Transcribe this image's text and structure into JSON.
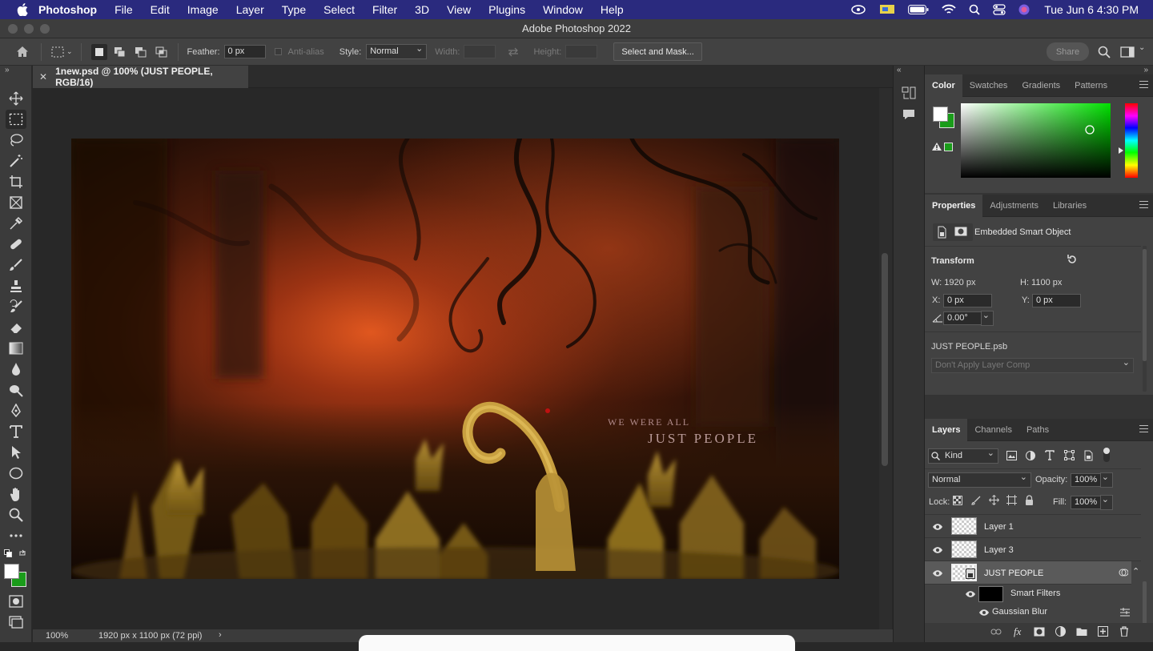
{
  "macmenu": {
    "app": "Photoshop",
    "items": [
      "File",
      "Edit",
      "Image",
      "Layer",
      "Type",
      "Select",
      "Filter",
      "3D",
      "View",
      "Plugins",
      "Window",
      "Help"
    ],
    "clock": "Tue Jun 6  4:30 PM"
  },
  "window": {
    "title": "Adobe Photoshop 2022"
  },
  "options": {
    "feather_label": "Feather:",
    "feather_value": "0 px",
    "antialias_label": "Anti-alias",
    "style_label": "Style:",
    "style_value": "Normal",
    "width_label": "Width:",
    "height_label": "Height:",
    "select_mask": "Select and Mask...",
    "share": "Share"
  },
  "document": {
    "tab_title": "1new.psd @ 100% (JUST PEOPLE, RGB/16)",
    "artwork_line1": "WE WERE ALL",
    "artwork_line2": "JUST PEOPLE"
  },
  "status": {
    "zoom": "100%",
    "size": "1920 px x 1100 px (72 ppi)"
  },
  "color_panel": {
    "tabs": [
      "Color",
      "Swatches",
      "Gradients",
      "Patterns"
    ],
    "active": "Color",
    "foreground": "#ffffff",
    "background": "#1a9c1a"
  },
  "properties": {
    "tabs": [
      "Properties",
      "Adjustments",
      "Libraries"
    ],
    "kind": "Embedded Smart Object",
    "transform_label": "Transform",
    "w": "W:  1920 px",
    "h": "H:  1100 px",
    "x_label": "X:",
    "x_value": "0 px",
    "y_label": "Y:",
    "y_value": "0 px",
    "angle": "0.00°",
    "file": "JUST PEOPLE.psb",
    "layer_comp": "Don't Apply Layer Comp"
  },
  "layers": {
    "tabs": [
      "Layers",
      "Channels",
      "Paths"
    ],
    "filter_kind": "Kind",
    "blend_mode": "Normal",
    "opacity_label": "Opacity:",
    "opacity": "100%",
    "lock_label": "Lock:",
    "fill_label": "Fill:",
    "fill": "100%",
    "items": [
      "Layer 1",
      "Layer 3",
      "JUST PEOPLE"
    ],
    "smart_filters": "Smart Filters",
    "gaussian_blur": "Gaussian Blur"
  }
}
